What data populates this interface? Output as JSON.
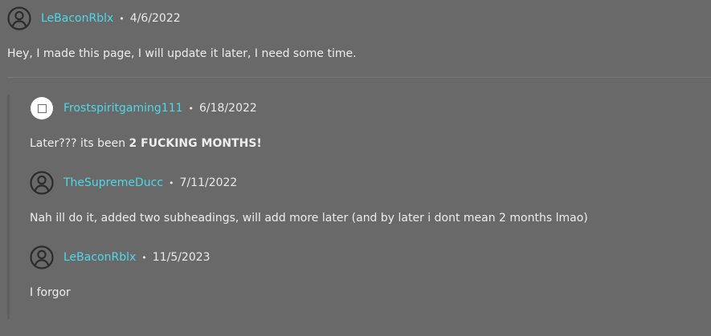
{
  "thread": {
    "root": {
      "author": "LeBaconRblx",
      "separator": "•",
      "date": "4/6/2022",
      "text": "Hey, I made this page, I will update it later, I need some time.",
      "avatar_icon": "user-circle-icon"
    },
    "replies": [
      {
        "author": "Frostspiritgaming111",
        "separator": "•",
        "date": "6/18/2022",
        "text_pre": "Later??? its been ",
        "text_bold": "2 FUCKING MONTHS!",
        "avatar_icon": "profile-image-icon"
      },
      {
        "author": "TheSupremeDucc",
        "separator": "•",
        "date": "7/11/2022",
        "text": "Nah ill do it, added two subheadings, will add more later (and by later i dont mean 2 months lmao)",
        "avatar_icon": "user-circle-icon"
      },
      {
        "author": "LeBaconRblx",
        "separator": "•",
        "date": "11/5/2023",
        "text": "I forgor",
        "avatar_icon": "user-circle-icon"
      }
    ]
  },
  "colors": {
    "background": "#696969",
    "author_link": "#4fd8e8",
    "text": "#eeeeee"
  }
}
